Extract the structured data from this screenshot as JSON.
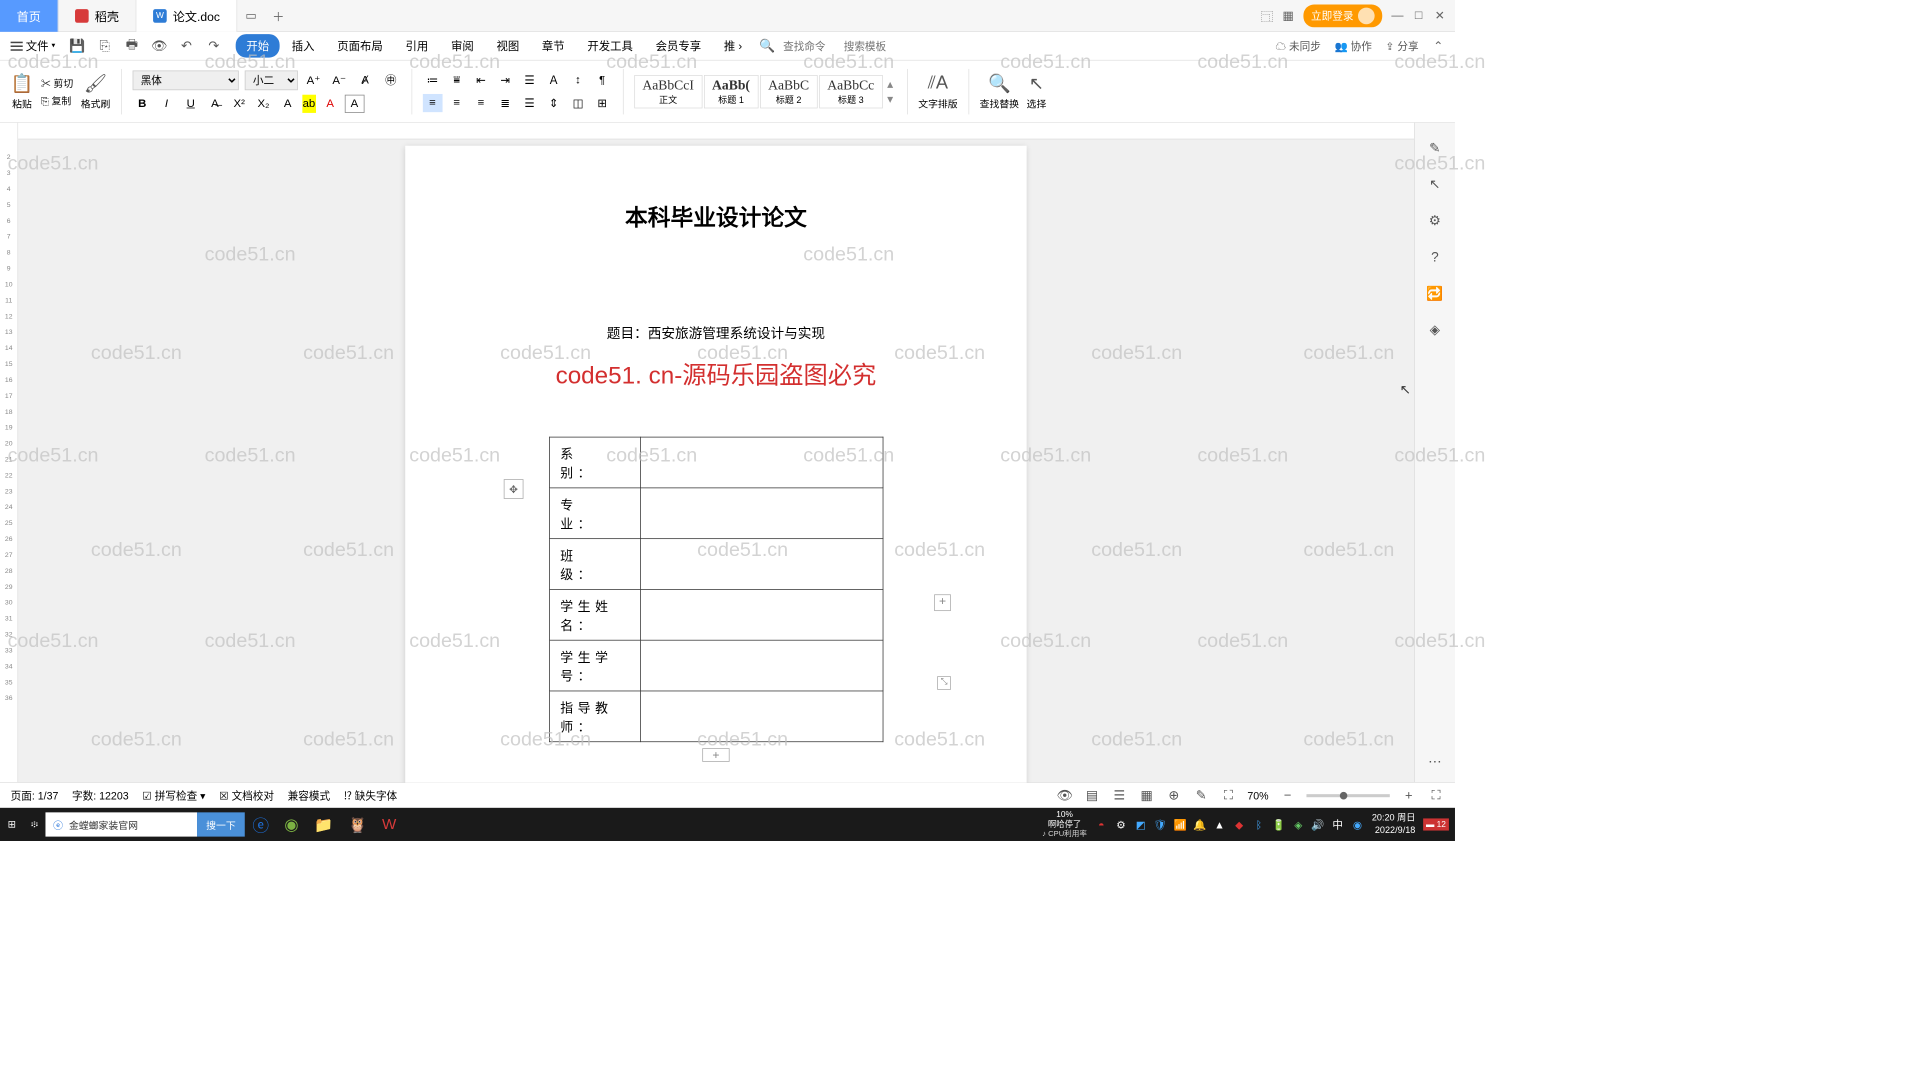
{
  "tabs": {
    "home": "首页",
    "docshell": "稻壳",
    "doc": "论文.doc"
  },
  "login": "立即登录",
  "menubar": {
    "file": "文件",
    "tabs": [
      "开始",
      "插入",
      "页面布局",
      "引用",
      "审阅",
      "视图",
      "章节",
      "开发工具",
      "会员专享",
      "推"
    ],
    "search_ph": "查找命令",
    "template_ph": "搜索模板",
    "unsync": "未同步",
    "collab": "协作",
    "share": "分享"
  },
  "ribbon": {
    "paste": "粘贴",
    "cut": "剪切",
    "copy": "复制",
    "brush": "格式刷",
    "font": "黑体",
    "size": "小二",
    "styles": [
      {
        "prev": "AaBbCcI",
        "name": "正文"
      },
      {
        "prev": "AaBb(",
        "name": "标题 1"
      },
      {
        "prev": "AaBbC",
        "name": "标题 2"
      },
      {
        "prev": "AaBbCc",
        "name": "标题 3"
      }
    ],
    "textdir": "文字排版",
    "findrep": "查找替换",
    "select": "选择"
  },
  "document": {
    "title": "本科毕业设计论文",
    "topic": "题目：西安旅游管理系统设计与实现",
    "watermark_msg": "code51. cn-源码乐园盗图必究",
    "fields": [
      "系　别：",
      "专　业：",
      "班　级：",
      "学生姓名：",
      "学生学号：",
      "指导教师："
    ]
  },
  "statusbar": {
    "page": "页面: 1/37",
    "words": "字数: 12203",
    "spell": "拼写检查",
    "proof": "文档校对",
    "compat": "兼容模式",
    "missing": "缺失字体",
    "zoom": "70%"
  },
  "taskbar": {
    "search": "金螳螂家装官网",
    "searchbtn": "搜一下",
    "cpu": "CPU利用率",
    "pause": "啊哈停了",
    "pct": "10%",
    "ime": "中",
    "time": "20:20",
    "day": "周日",
    "date": "2022/9/18",
    "notif": "12"
  },
  "watermark": "code51.cn"
}
